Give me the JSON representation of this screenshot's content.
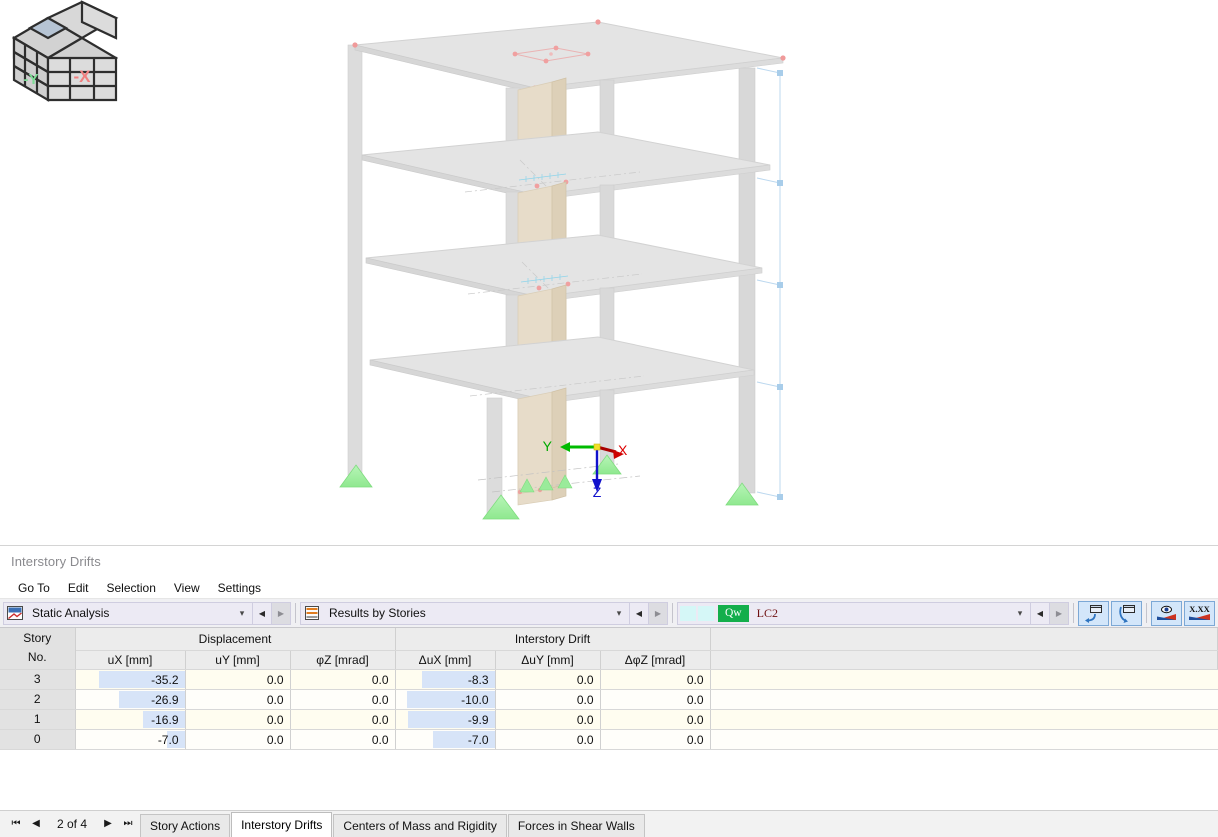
{
  "panel": {
    "title": "Interstory Drifts",
    "menu": [
      "Go To",
      "Edit",
      "Selection",
      "View",
      "Settings"
    ]
  },
  "toolbar": {
    "analysis_combo": {
      "value": "Static Analysis",
      "icon": "analysis-icon"
    },
    "results_combo": {
      "value": "Results by Stories",
      "icon": "stories-icon"
    },
    "loadcase_combo": {
      "badge": "Qw",
      "value": "LC2"
    },
    "buttons": [
      {
        "name": "import-window-button",
        "icon": "import-window-icon"
      },
      {
        "name": "export-window-button",
        "icon": "export-window-icon"
      },
      {
        "name": "visibility-button",
        "icon": "eye-gradient-icon"
      },
      {
        "name": "decimal-places-button",
        "icon": "x-xx-icon",
        "label": "X.XX"
      }
    ]
  },
  "table": {
    "group_headers": [
      {
        "label": "",
        "span": 1
      },
      {
        "label": "Displacement",
        "span": 3
      },
      {
        "label": "Interstory Drift",
        "span": 3
      },
      {
        "label": "",
        "span": 1
      }
    ],
    "corner_header": [
      "Story",
      "No."
    ],
    "columns": [
      "uX [mm]",
      "uY [mm]",
      "φZ [mrad]",
      "ΔuX [mm]",
      "ΔuY [mm]",
      "ΔφZ [mrad]"
    ],
    "rows": [
      {
        "story": "3",
        "values": [
          "-35.2",
          "0.0",
          "0.0",
          "-8.3",
          "0.0",
          "0.0"
        ],
        "bars": [
          0.78,
          0,
          0,
          0.73,
          0,
          0
        ]
      },
      {
        "story": "2",
        "values": [
          "-26.9",
          "0.0",
          "0.0",
          "-10.0",
          "0.0",
          "0.0"
        ],
        "bars": [
          0.6,
          0,
          0,
          0.88,
          0,
          0
        ]
      },
      {
        "story": "1",
        "values": [
          "-16.9",
          "0.0",
          "0.0",
          "-9.9",
          "0.0",
          "0.0"
        ],
        "bars": [
          0.38,
          0,
          0,
          0.87,
          0,
          0
        ]
      },
      {
        "story": "0",
        "values": [
          "-7.0",
          "0.0",
          "0.0",
          "-7.0",
          "0.0",
          "0.0"
        ],
        "bars": [
          0.16,
          0,
          0,
          0.62,
          0,
          0
        ]
      }
    ]
  },
  "statusbar": {
    "page_label": "2 of 4",
    "nav": {
      "first": "⏮",
      "prev": "◀",
      "next": "▶",
      "last": "⏭"
    },
    "tabs": [
      {
        "label": "Story Actions",
        "active": false
      },
      {
        "label": "Interstory Drifts",
        "active": true
      },
      {
        "label": "Centers of Mass and Rigidity",
        "active": false
      },
      {
        "label": "Forces in Shear Walls",
        "active": false
      }
    ]
  },
  "viewport": {
    "axes": {
      "x": "X",
      "y": "Y",
      "z": "Z"
    },
    "navcube": {
      "left_face": "-Y",
      "right_face": "-X"
    },
    "colors": {
      "slab": "#e2e2e2",
      "column": "#dcdcdc",
      "core_wall": "#e3d7c3",
      "support": "#a9f0a9",
      "axis_x": "#dd0000",
      "axis_y": "#00bb00",
      "axis_z": "#0000cc",
      "dimension_line": "#bcd8ef",
      "node": "#f0a0a0"
    }
  }
}
